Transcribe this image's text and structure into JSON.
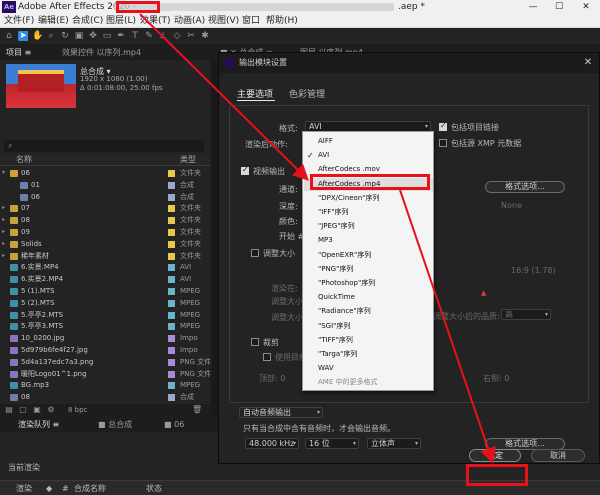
{
  "window": {
    "app_logo": "Ae",
    "title": "Adobe After Effects 2020 - ",
    "title_extra": ".aep *",
    "min": "—",
    "max": "☐",
    "close": "✕"
  },
  "menu": [
    "文件(F)",
    "编辑(E)",
    "合成(C)",
    "图层(L)",
    "效果(T)",
    "动画(A)",
    "视图(V)",
    "窗口",
    "帮助(H)"
  ],
  "project": {
    "tabs": [
      "项目 ≡",
      "效果控件 以序列.mp4"
    ],
    "composition": {
      "name": "总合成 ▾",
      "size": "1920 x 1080 (1.00)",
      "duration": "Δ 0:01:08:00, 25.00 fps"
    },
    "search_icon": "⌕",
    "columns": {
      "name": "名称",
      "type": "类型"
    },
    "bpc": "8 bpc",
    "items": [
      {
        "name": "06",
        "type": "文件夹",
        "indent": 0,
        "kind": "folder",
        "color": "#e8c94a",
        "expander": "▾"
      },
      {
        "name": "01",
        "type": "合成",
        "indent": 1,
        "kind": "comp",
        "color": "#9aa7c9",
        "expander": ""
      },
      {
        "name": "06",
        "type": "合成",
        "indent": 1,
        "kind": "comp",
        "color": "#9aa7c9",
        "expander": ""
      },
      {
        "name": "07",
        "type": "文件夹",
        "indent": 0,
        "kind": "folder",
        "color": "#e8c94a",
        "expander": "▸"
      },
      {
        "name": "08",
        "type": "文件夹",
        "indent": 0,
        "kind": "folder",
        "color": "#e8c94a",
        "expander": "▸"
      },
      {
        "name": "09",
        "type": "文件夹",
        "indent": 0,
        "kind": "folder",
        "color": "#e8c94a",
        "expander": "▸"
      },
      {
        "name": "Solids",
        "type": "文件夹",
        "indent": 0,
        "kind": "folder",
        "color": "#e8c94a",
        "expander": "▸"
      },
      {
        "name": "稀年素材",
        "type": "文件夹",
        "indent": 0,
        "kind": "folder",
        "color": "#e8c94a",
        "expander": "▸"
      },
      {
        "name": "6.实景.MP4",
        "type": "AVI",
        "indent": 0,
        "kind": "video",
        "color": "#6bb3c9",
        "expander": ""
      },
      {
        "name": "6.实景2.MP4",
        "type": "AVI",
        "indent": 0,
        "kind": "video",
        "color": "#6bb3c9",
        "expander": ""
      },
      {
        "name": "5 (1).MTS",
        "type": "MPEG",
        "indent": 0,
        "kind": "video",
        "color": "#6bb3c9",
        "expander": ""
      },
      {
        "name": "5 (2).MTS",
        "type": "MPEG",
        "indent": 0,
        "kind": "video",
        "color": "#6bb3c9",
        "expander": ""
      },
      {
        "name": "5.亭亭2.MTS",
        "type": "MPEG",
        "indent": 0,
        "kind": "video",
        "color": "#6bb3c9",
        "expander": ""
      },
      {
        "name": "5.亭亭3.MTS",
        "type": "MPEG",
        "indent": 0,
        "kind": "video",
        "color": "#6bb3c9",
        "expander": ""
      },
      {
        "name": "10_0200.jpg",
        "type": "Impo",
        "indent": 0,
        "kind": "image",
        "color": "#a78bd6",
        "expander": ""
      },
      {
        "name": "5d979b6fe4f27.jpg",
        "type": "Impo",
        "indent": 0,
        "kind": "image",
        "color": "#a78bd6",
        "expander": ""
      },
      {
        "name": "5d4a137edc7a3.png",
        "type": "PNG 文件",
        "indent": 0,
        "kind": "image",
        "color": "#a78bd6",
        "expander": ""
      },
      {
        "name": "暖阳Logo01^1.png",
        "type": "PNG 文件",
        "indent": 0,
        "kind": "image",
        "color": "#a78bd6",
        "expander": ""
      },
      {
        "name": "BG.mp3",
        "type": "MPEG",
        "indent": 0,
        "kind": "audio",
        "color": "#6bb3c9",
        "expander": ""
      },
      {
        "name": "08",
        "type": "合成",
        "indent": 0,
        "kind": "comp",
        "color": "#9aa7c9",
        "expander": ""
      }
    ]
  },
  "right_tabs": [
    "■ ✕ 总合成 ≡",
    "图层 以序列.mp4"
  ],
  "render_queue": {
    "tabs": [
      "渲染队列 ≡",
      "■ 总合成",
      "■ 06"
    ],
    "current": "当前渲染",
    "columns": [
      "渲染",
      "◆",
      "#",
      "合成名称",
      "状态"
    ]
  },
  "dialog": {
    "title": "输出模块设置",
    "close": "✕",
    "tabs": {
      "main": "主要选项",
      "color": "色彩管理"
    },
    "format_label": "格式:",
    "format_value": "AVI",
    "include_link": "包括项目链接",
    "include_xmp": "包括源 XMP 元数据",
    "post_render": "渲染后动作:",
    "video_output": "视频输出",
    "channel": "通道:",
    "format_options": "格式选项...",
    "depth": "深度:",
    "none": "None",
    "color": "颜色:",
    "start": "开始 #:",
    "resize": "调整大小",
    "aspect": "16:9 (1.78)",
    "render_at": "渲染在:",
    "resize_to": "调整大小到:",
    "resize_pct": "调整大小 %:",
    "quality_label": "调整大小后的品质:",
    "quality_value": "高",
    "crop": "裁剪",
    "use_roi": "使用目标区域",
    "top": "顶部: 0",
    "right": "右侧: 0",
    "auto_audio": "自动音频输出",
    "audio_note": "只有当合成中含有音频时，才会输出音频。",
    "audio_rate": "48.000 kHz",
    "audio_bits": "16 位",
    "audio_channels": "立体声",
    "audio_options": "格式选项...",
    "ok": "确定",
    "cancel": "取消",
    "arrow": "▾"
  },
  "format_list": [
    {
      "label": "AIFF",
      "checked": false,
      "hover": false,
      "disabled": false
    },
    {
      "label": "AVI",
      "checked": true,
      "hover": false,
      "disabled": false
    },
    {
      "label": "AfterCodecs .mov",
      "checked": false,
      "hover": false,
      "disabled": false
    },
    {
      "label": "AfterCodecs .mp4",
      "checked": false,
      "hover": true,
      "disabled": false
    },
    {
      "label": "\"DPX/Cineon\"序列",
      "checked": false,
      "hover": false,
      "disabled": false
    },
    {
      "label": "\"IFF\"序列",
      "checked": false,
      "hover": false,
      "disabled": false
    },
    {
      "label": "\"JPEG\"序列",
      "checked": false,
      "hover": false,
      "disabled": false
    },
    {
      "label": "MP3",
      "checked": false,
      "hover": false,
      "disabled": false
    },
    {
      "label": "\"OpenEXR\"序列",
      "checked": false,
      "hover": false,
      "disabled": false
    },
    {
      "label": "\"PNG\"序列",
      "checked": false,
      "hover": false,
      "disabled": false
    },
    {
      "label": "\"Photoshop\"序列",
      "checked": false,
      "hover": false,
      "disabled": false
    },
    {
      "label": "QuickTime",
      "checked": false,
      "hover": false,
      "disabled": false
    },
    {
      "label": "\"Radiance\"序列",
      "checked": false,
      "hover": false,
      "disabled": false
    },
    {
      "label": "\"SGI\"序列",
      "checked": false,
      "hover": false,
      "disabled": false
    },
    {
      "label": "\"TIFF\"序列",
      "checked": false,
      "hover": false,
      "disabled": false
    },
    {
      "label": "\"Targa\"序列",
      "checked": false,
      "hover": false,
      "disabled": false
    },
    {
      "label": "WAV",
      "checked": false,
      "hover": false,
      "disabled": false
    },
    {
      "label": "AME 中的更多格式",
      "checked": false,
      "hover": false,
      "disabled": true
    }
  ],
  "checkmark": "✓",
  "colors": {
    "annotation": "#e8101a",
    "accent": "#2d8ceb"
  }
}
